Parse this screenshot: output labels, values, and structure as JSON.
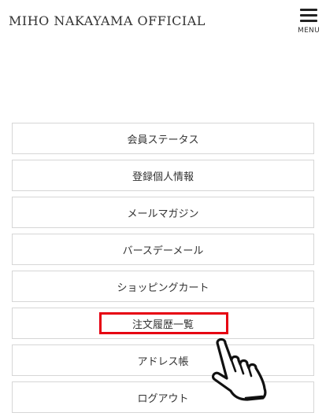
{
  "header": {
    "site_title": "MIHO NAKAYAMA OFFICIAL",
    "menu_label": "MENU",
    "menu_icon": "hamburger-icon"
  },
  "nav": {
    "items": [
      {
        "label": "会員ステータス"
      },
      {
        "label": "登録個人情報"
      },
      {
        "label": "メールマガジン"
      },
      {
        "label": "バースデーメール"
      },
      {
        "label": "ショッピングカート"
      },
      {
        "label": "注文履歴一覧",
        "highlighted": true
      },
      {
        "label": "アドレス帳"
      },
      {
        "label": "ログアウト"
      }
    ]
  },
  "annotation": {
    "pointer_icon": "hand-pointer-icon",
    "highlight_color": "#e60012"
  }
}
